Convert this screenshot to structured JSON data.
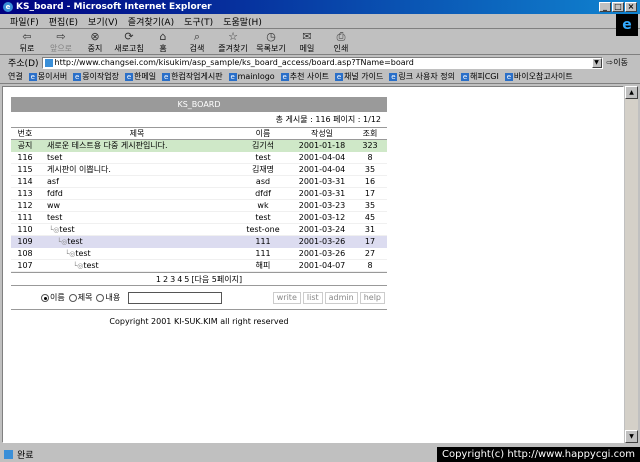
{
  "window": {
    "title": "KS_board - Microsoft Internet Explorer",
    "buttons": [
      "_",
      "□",
      "×"
    ]
  },
  "menu": [
    "파일(F)",
    "편집(E)",
    "보기(V)",
    "즐겨찾기(A)",
    "도구(T)",
    "도움말(H)"
  ],
  "toolbar": [
    {
      "label": "뒤로",
      "icon": "⇦"
    },
    {
      "label": "앞으로",
      "icon": "⇨"
    },
    {
      "label": "중지",
      "icon": "⊗"
    },
    {
      "label": "새로고침",
      "icon": "⟳"
    },
    {
      "label": "홈",
      "icon": "⌂"
    },
    {
      "label": "검색",
      "icon": "⌕"
    },
    {
      "label": "즐겨찾기",
      "icon": "☆"
    },
    {
      "label": "목록보기",
      "icon": "◷"
    },
    {
      "label": "메일",
      "icon": "✉"
    },
    {
      "label": "인쇄",
      "icon": "⎙"
    }
  ],
  "address": {
    "label": "주소(D)",
    "url": "http://www.changsei.com/kisukim/asp_sample/ks_board_access/board.asp?TName=board",
    "go": "이동"
  },
  "links": {
    "label": "연결",
    "items": [
      "몽이서버",
      "몽이작업장",
      "한메일",
      "한컴작업게시판",
      "mainlogo",
      "추천 사이트",
      "채널 가이드",
      "링크 사용자 정의",
      "해피CGI",
      "바이오참고사이트"
    ]
  },
  "board": {
    "title": "KS_BOARD",
    "summary": "총 게시물 : 116  페이지 : 1/12",
    "columns": [
      "번호",
      "제목",
      "이름",
      "작성일",
      "조회"
    ],
    "rows": [
      {
        "num": "공지",
        "title": "새로운 테스트용 다중 게시판입니다.",
        "name": "김기석",
        "date": "2001-01-18",
        "views": "323",
        "depth": 0,
        "kind": "notice"
      },
      {
        "num": "116",
        "title": "tset",
        "name": "test",
        "date": "2001-04-04",
        "views": "8",
        "depth": 0,
        "kind": "row"
      },
      {
        "num": "115",
        "title": "게시판이 이쁩니다.",
        "name": "김재명",
        "date": "2001-04-04",
        "views": "35",
        "depth": 0,
        "kind": "row"
      },
      {
        "num": "114",
        "title": "asf",
        "name": "asd",
        "date": "2001-03-31",
        "views": "16",
        "depth": 0,
        "kind": "row"
      },
      {
        "num": "113",
        "title": "fdfd",
        "name": "dfdf",
        "date": "2001-03-31",
        "views": "17",
        "depth": 0,
        "kind": "row"
      },
      {
        "num": "112",
        "title": "ww",
        "name": "wk",
        "date": "2001-03-23",
        "views": "35",
        "depth": 0,
        "kind": "row"
      },
      {
        "num": "111",
        "title": "test",
        "name": "test",
        "date": "2001-03-12",
        "views": "45",
        "depth": 0,
        "kind": "row"
      },
      {
        "num": "110",
        "title": "test",
        "name": "test-one",
        "date": "2001-03-24",
        "views": "31",
        "depth": 1,
        "kind": "row"
      },
      {
        "num": "109",
        "title": "test",
        "name": "111",
        "date": "2001-03-26",
        "views": "17",
        "depth": 2,
        "kind": "highlight"
      },
      {
        "num": "108",
        "title": "test",
        "name": "111",
        "date": "2001-03-26",
        "views": "27",
        "depth": 3,
        "kind": "row"
      },
      {
        "num": "107",
        "title": "test",
        "name": "해피",
        "date": "2001-04-07",
        "views": "8",
        "depth": 4,
        "kind": "row"
      }
    ],
    "pages": [
      "1",
      "2",
      "3",
      "4",
      "5",
      "[다음 5페이지]"
    ],
    "search": {
      "options": [
        "이름",
        "제목",
        "내용"
      ],
      "selected": 0
    },
    "actions": [
      "write",
      "list",
      "admin",
      "help"
    ],
    "copyright": "Copyright 2001 KI-SUK.KIM all right reserved"
  },
  "status": {
    "text": "완료"
  },
  "banner": "Copyright(c) http://www.happycgi.com"
}
